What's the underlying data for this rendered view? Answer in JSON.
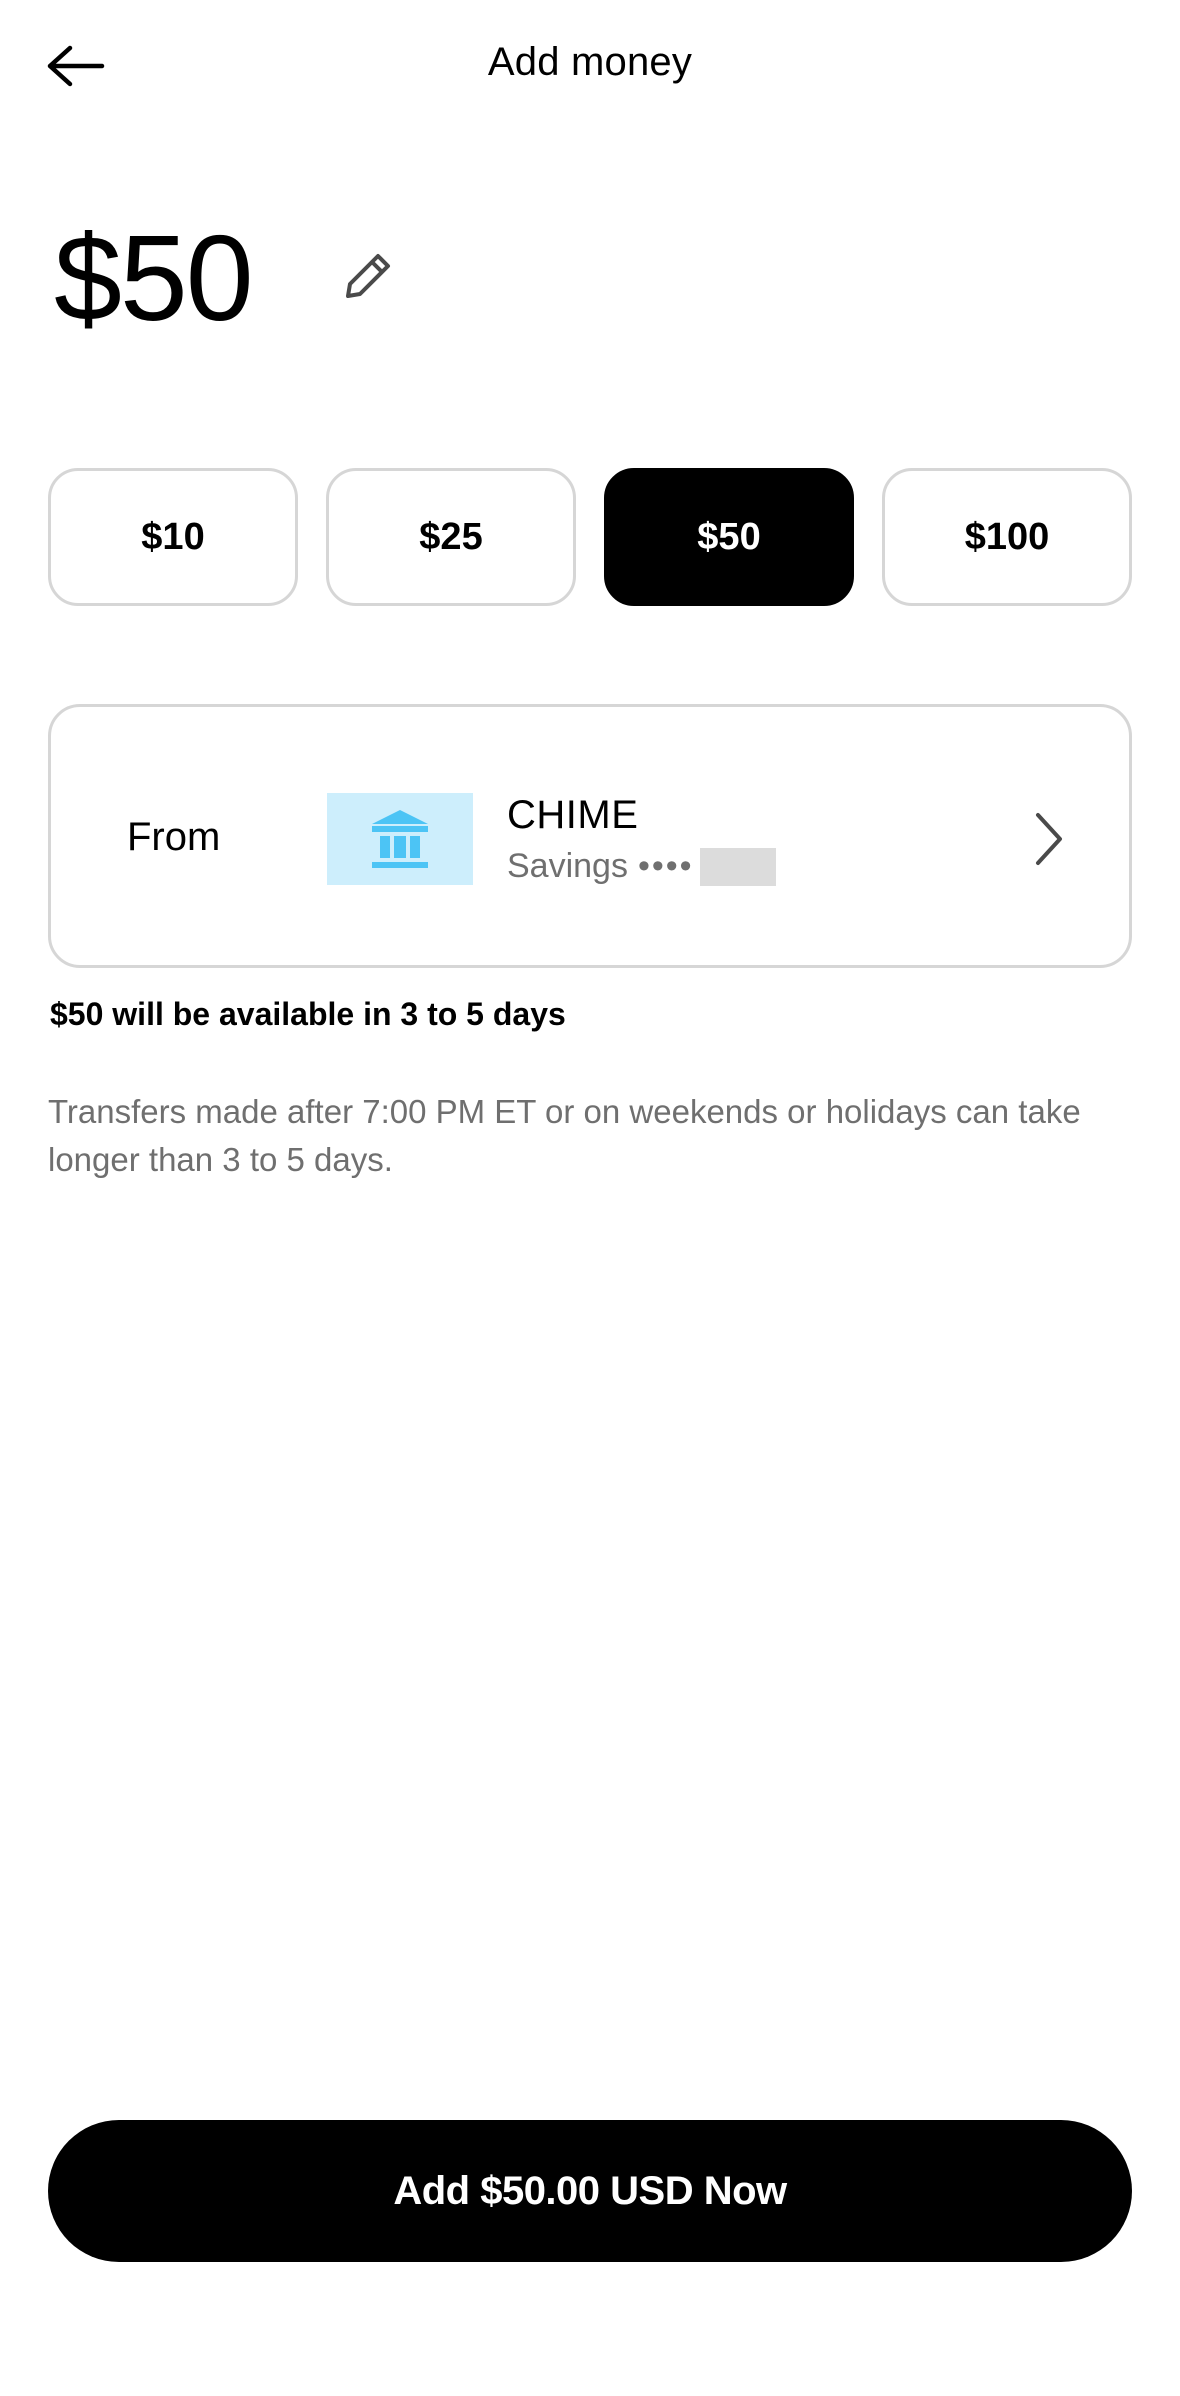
{
  "header": {
    "title": "Add money",
    "back_icon": "arrow-left-icon"
  },
  "amount": {
    "value": "$50",
    "edit_icon": "pencil-icon"
  },
  "presets": [
    {
      "label": "$10",
      "selected": false
    },
    {
      "label": "$25",
      "selected": false
    },
    {
      "label": "$50",
      "selected": true
    },
    {
      "label": "$100",
      "selected": false
    }
  ],
  "from": {
    "label": "From",
    "bank_name": "CHIME",
    "account_type": "Savings",
    "account_mask": "••••",
    "logo_icon": "bank-icon",
    "logo_color": "#4cc4f5",
    "logo_bg": "#cdeefc"
  },
  "availability": "$50 will be available in 3 to 5 days",
  "note": "Transfers made after 7:00 PM ET or on weekends or holidays can take longer than 3 to 5 days.",
  "cta": {
    "label": "Add $50.00 USD Now"
  },
  "colors": {
    "primary": "#000000",
    "border": "#d6d6d6",
    "secondary_text": "#6f6f6f"
  }
}
